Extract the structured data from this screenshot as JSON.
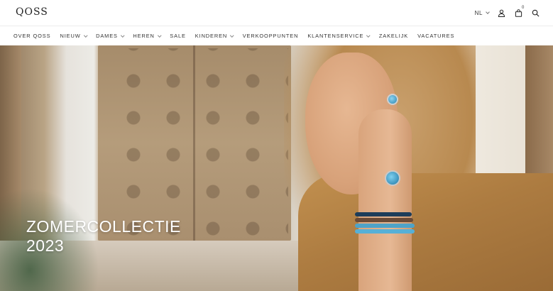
{
  "header": {
    "logo": "QOSS",
    "language": "NL",
    "cart_count": "0"
  },
  "nav": {
    "items": [
      {
        "label": "OVER QOSS",
        "has_dropdown": false
      },
      {
        "label": "NIEUW",
        "has_dropdown": true
      },
      {
        "label": "DAMES",
        "has_dropdown": true
      },
      {
        "label": "HEREN",
        "has_dropdown": true
      },
      {
        "label": "SALE",
        "has_dropdown": false
      },
      {
        "label": "KINDEREN",
        "has_dropdown": true
      },
      {
        "label": "VERKOOPPUNTEN",
        "has_dropdown": false
      },
      {
        "label": "KLANTENSERVICE",
        "has_dropdown": true
      },
      {
        "label": "ZAKELIJK",
        "has_dropdown": false
      },
      {
        "label": "VACATURES",
        "has_dropdown": false
      }
    ]
  },
  "hero": {
    "title_line1": "ZOMERCOLLECTIE",
    "title_line2": "2023"
  },
  "icons": {
    "account": "user-icon",
    "cart": "shopping-bag-icon",
    "search": "search-icon"
  }
}
